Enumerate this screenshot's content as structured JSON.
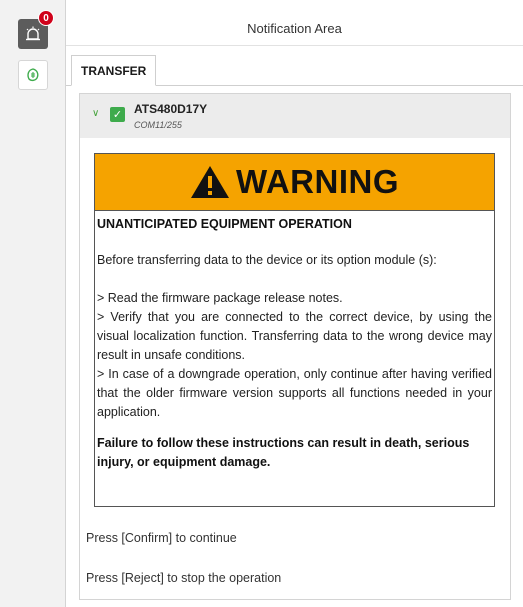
{
  "notification_badge": "0",
  "header": {
    "title": "Notification Area"
  },
  "tabs": [
    {
      "label": "TRANSFER"
    }
  ],
  "device": {
    "name": "ATS480D17Y",
    "port": "COM11/255"
  },
  "warning": {
    "title": "WARNING",
    "heading": "UNANTICIPATED EQUIPMENT OPERATION",
    "intro": "Before transferring data to the device or its option module (s):",
    "items": [
      "> Read the firmware package release notes.",
      "> Verify that you are connected to the correct device, by using the visual localization function. Transferring data to the wrong device may result in unsafe conditions.",
      "> In case of a downgrade operation, only continue after having verified that the older firmware version supports all functions needed in your application."
    ],
    "footer": "Failure to follow these instructions can result in death, serious injury, or equipment damage."
  },
  "prompts": {
    "confirm": "Press [Confirm] to continue",
    "reject": "Press [Reject] to stop the operation"
  },
  "colors": {
    "warning_banner": "#f5a300",
    "check": "#3eab4c",
    "badge": "#d0021b"
  },
  "icons": {
    "notification": "alarm-bell-icon",
    "transfer": "transfer-leaf-icon",
    "warning": "warning-triangle-icon"
  }
}
